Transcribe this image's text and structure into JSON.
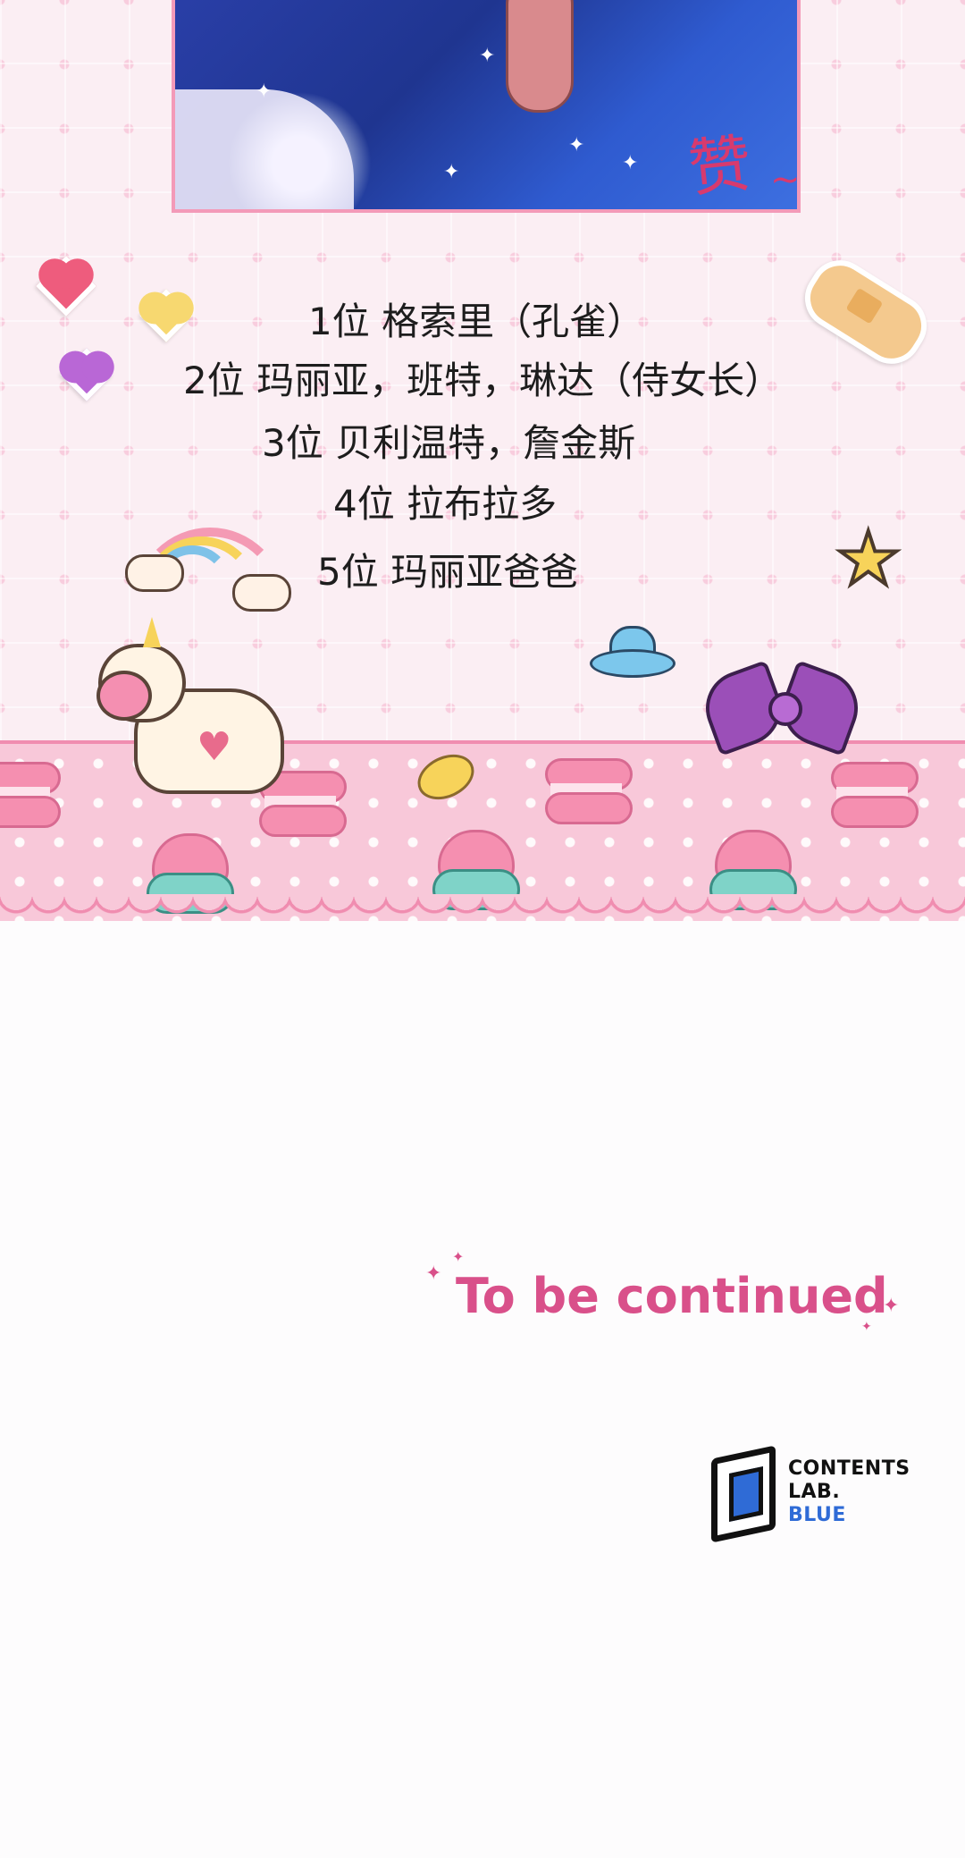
{
  "panel": {
    "exclamation": "赞",
    "exclamation_tilde": "~",
    "rankings": [
      "1位 格索里（孔雀）",
      "2位 玛丽亚，班特，琳达（侍女长）",
      "3位 贝利温特，詹金斯",
      "4位 拉布拉多",
      "5位 玛丽亚爸爸"
    ]
  },
  "ending": {
    "text": "To be continued"
  },
  "logo": {
    "line1": "CONTENTS",
    "line2": "LAB.",
    "line3": "BLUE"
  }
}
